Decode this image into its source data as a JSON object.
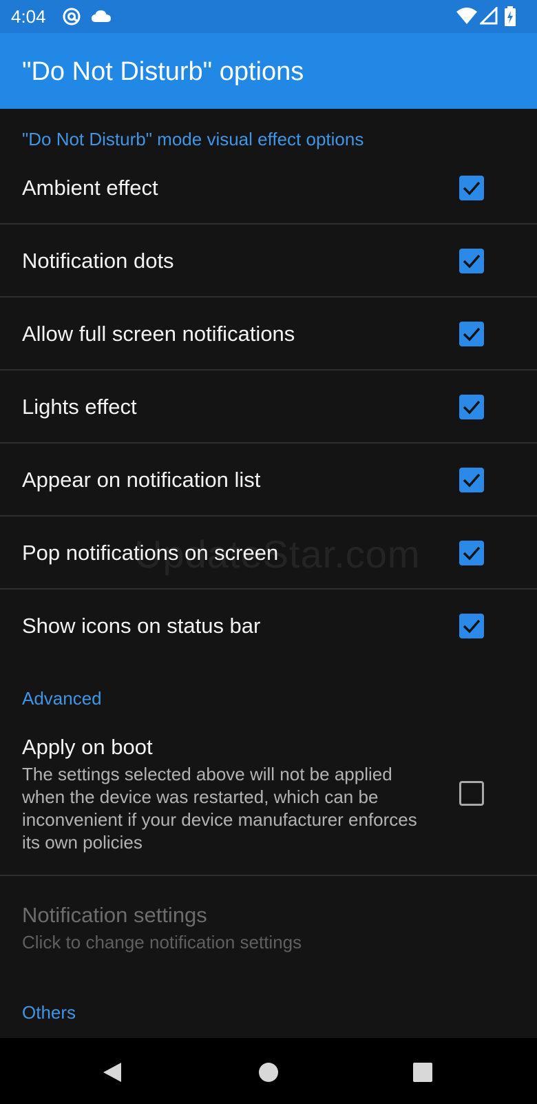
{
  "status_bar": {
    "time": "4:04",
    "left_icons": [
      "at-sign-icon",
      "cloud-icon"
    ],
    "right_icons": [
      "wifi-icon",
      "signal-icon",
      "battery-charging-icon"
    ]
  },
  "app_bar": {
    "title": "\"Do Not Disturb\" options",
    "color": "#2288e6"
  },
  "sections": {
    "visual_effects": {
      "header": "\"Do Not Disturb\" mode visual effect options",
      "items": [
        {
          "label": "Ambient effect",
          "checked": true
        },
        {
          "label": "Notification dots",
          "checked": true
        },
        {
          "label": "Allow full screen notifications",
          "checked": true
        },
        {
          "label": "Lights effect",
          "checked": true
        },
        {
          "label": "Appear on notification list",
          "checked": true
        },
        {
          "label": "Pop notifications on screen",
          "checked": true
        },
        {
          "label": "Show icons on status bar",
          "checked": true
        }
      ]
    },
    "advanced": {
      "header": "Advanced",
      "apply_on_boot": {
        "title": "Apply on boot",
        "summary": "The settings selected above will not be applied when the device was restarted, which can be inconvenient if your device manufacturer enforces its own policies",
        "checked": false
      },
      "notification_settings": {
        "title": "Notification settings",
        "summary": "Click to change notification settings",
        "enabled": false
      }
    },
    "others": {
      "header": "Others"
    }
  },
  "watermark": "UpdateStar.com",
  "nav_bar": {
    "icons": [
      "back-icon",
      "home-icon",
      "recents-icon"
    ]
  },
  "colors": {
    "accent": "#2b8ae8",
    "background": "#141414",
    "status_bar": "#1f7ad6"
  }
}
